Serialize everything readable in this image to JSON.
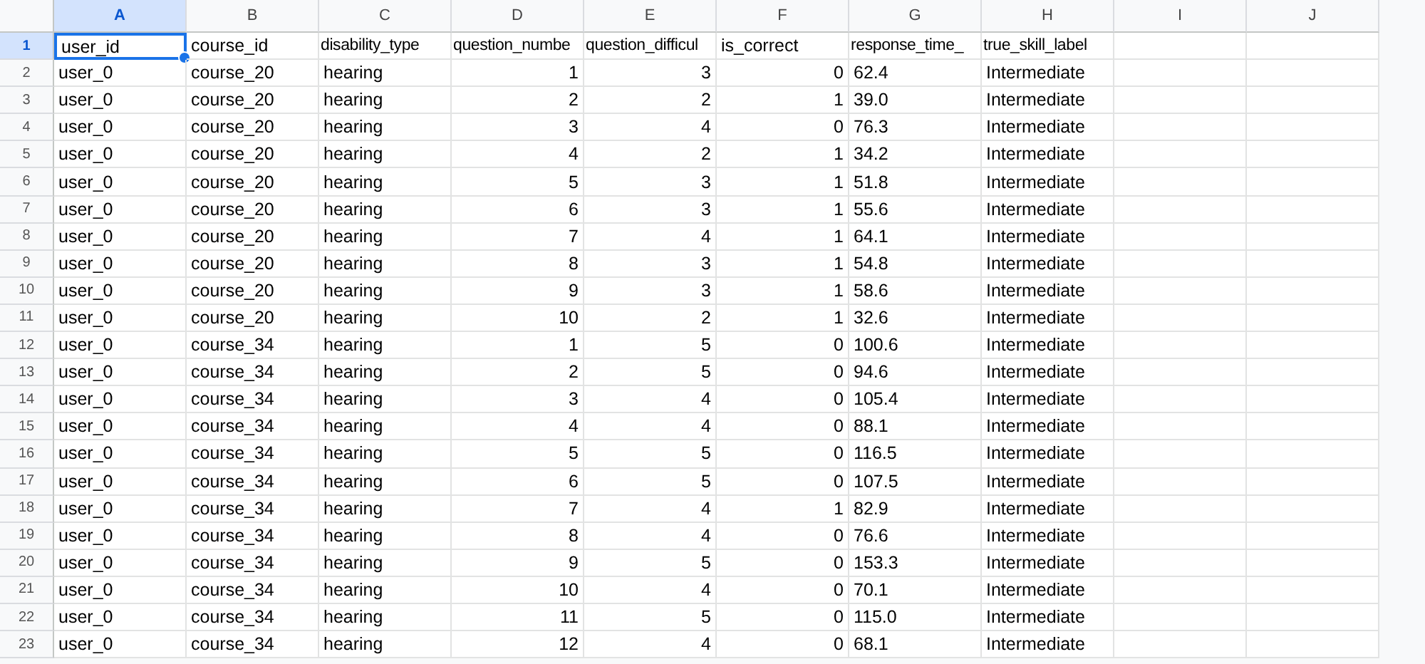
{
  "columns": [
    {
      "letter": "A",
      "kind": "text",
      "selected": true
    },
    {
      "letter": "B",
      "kind": "text",
      "selected": false
    },
    {
      "letter": "C",
      "kind": "text",
      "selected": false
    },
    {
      "letter": "D",
      "kind": "number",
      "selected": false
    },
    {
      "letter": "E",
      "kind": "number",
      "selected": false
    },
    {
      "letter": "F",
      "kind": "number",
      "selected": false
    },
    {
      "letter": "G",
      "kind": "text",
      "selected": false
    },
    {
      "letter": "H",
      "kind": "text",
      "selected": false
    },
    {
      "letter": "I",
      "kind": "text",
      "selected": false
    },
    {
      "letter": "J",
      "kind": "text",
      "selected": false
    }
  ],
  "rows": [
    {
      "number": "1",
      "selected": true,
      "header": true,
      "cells": [
        "user_id",
        "course_id",
        "disability_type",
        "question_numbe",
        "question_difficul",
        "is_correct",
        "response_time_",
        "true_skill_label"
      ]
    },
    {
      "number": "2",
      "selected": false,
      "cells": [
        "user_0",
        "course_20",
        "hearing",
        "1",
        "3",
        "0",
        "62.4",
        "Intermediate"
      ]
    },
    {
      "number": "3",
      "selected": false,
      "cells": [
        "user_0",
        "course_20",
        "hearing",
        "2",
        "2",
        "1",
        "39.0",
        "Intermediate"
      ]
    },
    {
      "number": "4",
      "selected": false,
      "cells": [
        "user_0",
        "course_20",
        "hearing",
        "3",
        "4",
        "0",
        "76.3",
        "Intermediate"
      ]
    },
    {
      "number": "5",
      "selected": false,
      "cells": [
        "user_0",
        "course_20",
        "hearing",
        "4",
        "2",
        "1",
        "34.2",
        "Intermediate"
      ]
    },
    {
      "number": "6",
      "selected": false,
      "cells": [
        "user_0",
        "course_20",
        "hearing",
        "5",
        "3",
        "1",
        "51.8",
        "Intermediate"
      ]
    },
    {
      "number": "7",
      "selected": false,
      "cells": [
        "user_0",
        "course_20",
        "hearing",
        "6",
        "3",
        "1",
        "55.6",
        "Intermediate"
      ]
    },
    {
      "number": "8",
      "selected": false,
      "cells": [
        "user_0",
        "course_20",
        "hearing",
        "7",
        "4",
        "1",
        "64.1",
        "Intermediate"
      ]
    },
    {
      "number": "9",
      "selected": false,
      "cells": [
        "user_0",
        "course_20",
        "hearing",
        "8",
        "3",
        "1",
        "54.8",
        "Intermediate"
      ]
    },
    {
      "number": "10",
      "selected": false,
      "cells": [
        "user_0",
        "course_20",
        "hearing",
        "9",
        "3",
        "1",
        "58.6",
        "Intermediate"
      ]
    },
    {
      "number": "11",
      "selected": false,
      "cells": [
        "user_0",
        "course_20",
        "hearing",
        "10",
        "2",
        "1",
        "32.6",
        "Intermediate"
      ]
    },
    {
      "number": "12",
      "selected": false,
      "cells": [
        "user_0",
        "course_34",
        "hearing",
        "1",
        "5",
        "0",
        "100.6",
        "Intermediate"
      ]
    },
    {
      "number": "13",
      "selected": false,
      "cells": [
        "user_0",
        "course_34",
        "hearing",
        "2",
        "5",
        "0",
        "94.6",
        "Intermediate"
      ]
    },
    {
      "number": "14",
      "selected": false,
      "cells": [
        "user_0",
        "course_34",
        "hearing",
        "3",
        "4",
        "0",
        "105.4",
        "Intermediate"
      ]
    },
    {
      "number": "15",
      "selected": false,
      "cells": [
        "user_0",
        "course_34",
        "hearing",
        "4",
        "4",
        "0",
        "88.1",
        "Intermediate"
      ]
    },
    {
      "number": "16",
      "selected": false,
      "cells": [
        "user_0",
        "course_34",
        "hearing",
        "5",
        "5",
        "0",
        "116.5",
        "Intermediate"
      ]
    },
    {
      "number": "17",
      "selected": false,
      "cells": [
        "user_0",
        "course_34",
        "hearing",
        "6",
        "5",
        "0",
        "107.5",
        "Intermediate"
      ]
    },
    {
      "number": "18",
      "selected": false,
      "cells": [
        "user_0",
        "course_34",
        "hearing",
        "7",
        "4",
        "1",
        "82.9",
        "Intermediate"
      ]
    },
    {
      "number": "19",
      "selected": false,
      "cells": [
        "user_0",
        "course_34",
        "hearing",
        "8",
        "4",
        "0",
        "76.6",
        "Intermediate"
      ]
    },
    {
      "number": "20",
      "selected": false,
      "cells": [
        "user_0",
        "course_34",
        "hearing",
        "9",
        "5",
        "0",
        "153.3",
        "Intermediate"
      ]
    },
    {
      "number": "21",
      "selected": false,
      "cells": [
        "user_0",
        "course_34",
        "hearing",
        "10",
        "4",
        "0",
        "70.1",
        "Intermediate"
      ]
    },
    {
      "number": "22",
      "selected": false,
      "cells": [
        "user_0",
        "course_34",
        "hearing",
        "11",
        "5",
        "0",
        "115.0",
        "Intermediate"
      ]
    },
    {
      "number": "23",
      "selected": false,
      "cells": [
        "user_0",
        "course_34",
        "hearing",
        "12",
        "4",
        "0",
        "68.1",
        "Intermediate"
      ]
    }
  ]
}
